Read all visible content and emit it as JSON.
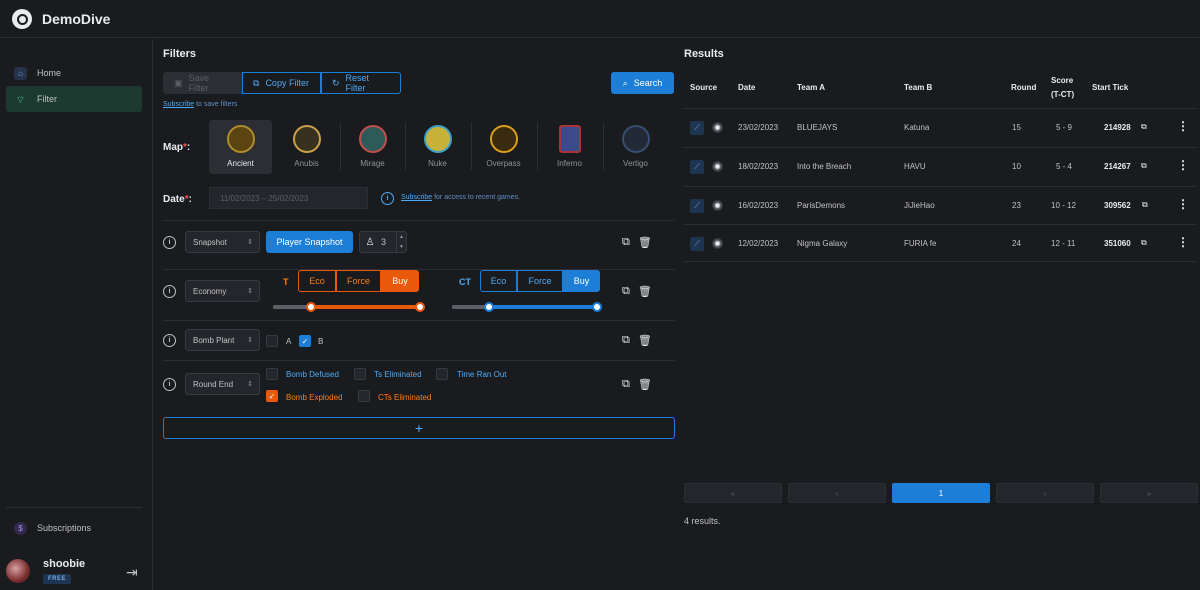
{
  "app": {
    "title": "DemoDive"
  },
  "sidebar": {
    "items": [
      {
        "label": "Home",
        "icon": "home-icon"
      },
      {
        "label": "Filter",
        "icon": "filter-icon",
        "active": true
      }
    ],
    "subscriptions_label": "Subscriptions",
    "user": {
      "name": "shoobie",
      "plan": "FREE"
    }
  },
  "filters": {
    "title": "Filters",
    "save_label": "Save Filter",
    "copy_label": "Copy Filter",
    "reset_label": "Reset Filter",
    "search_label": "Search",
    "subscribe_link": "Subscribe",
    "subscribe_note": " to save filters",
    "map_label": "Map",
    "maps": [
      {
        "name": "Ancient",
        "color": "#b08d2c",
        "active": true
      },
      {
        "name": "Anubis",
        "color": "#c9a24a"
      },
      {
        "name": "Mirage",
        "color": "#c0504d"
      },
      {
        "name": "Nuke",
        "color": "#3ea2c8"
      },
      {
        "name": "Overpass",
        "color": "#d8a018"
      },
      {
        "name": "Inferno",
        "color": "#a8343a"
      },
      {
        "name": "Vertigo",
        "color": "#4a6fa8"
      }
    ],
    "date_label": "Date",
    "date_range": "11/02/2023 – 25/02/2023",
    "date_subscribe_link": "Subscribe",
    "date_note": " for access to recent games.",
    "rows": {
      "snapshot": {
        "select": "Snapshot",
        "button": "Player Snapshot",
        "count": "3"
      },
      "economy": {
        "select": "Economy",
        "t_label": "T",
        "ct_label": "CT",
        "t_options": [
          "Eco",
          "Force",
          "Buy"
        ],
        "t_selected": "Buy",
        "ct_options": [
          "Eco",
          "Force",
          "Buy"
        ],
        "ct_selected": "Buy"
      },
      "bomb_plant": {
        "select": "Bomb Plant",
        "a_label": "A",
        "b_label": "B",
        "a_checked": false,
        "b_checked": true
      },
      "round_end": {
        "select": "Round End",
        "options": [
          {
            "label": "Bomb Defused",
            "checked": false
          },
          {
            "label": "Ts Eliminated",
            "checked": false
          },
          {
            "label": "Time Ran Out",
            "checked": false
          },
          {
            "label": "Bomb Exploded",
            "checked": true
          },
          {
            "label": "CTs Eliminated",
            "checked": false
          }
        ]
      }
    },
    "add_label": "+"
  },
  "results": {
    "title": "Results",
    "headers": {
      "source": "Source",
      "date": "Date",
      "team_a": "Team A",
      "team_b": "Team B",
      "round": "Round",
      "score": "Score",
      "score_sub": "(T-CT)",
      "start_tick": "Start Tick"
    },
    "rows": [
      {
        "date": "23/02/2023",
        "team_a": "BLUEJAYS",
        "team_b": "Katuna",
        "round": "15",
        "score": "5 - 9",
        "tick": "214928"
      },
      {
        "date": "18/02/2023",
        "team_a": "Into the Breach",
        "team_b": "HAVU",
        "round": "10",
        "score": "5 - 4",
        "tick": "214267"
      },
      {
        "date": "16/02/2023",
        "team_a": "ParisDemons",
        "team_b": "JiJieHao",
        "round": "23",
        "score": "10 - 12",
        "tick": "309562"
      },
      {
        "date": "12/02/2023",
        "team_a": "Nigma Galaxy",
        "team_b": "FURIA fe",
        "round": "24",
        "score": "12 - 11",
        "tick": "351060"
      }
    ],
    "pagination": {
      "first": "«",
      "prev": "‹",
      "current": "1",
      "next": "›",
      "last": "»"
    },
    "count_text": "4 results."
  },
  "colors": {
    "accent": "#1c7ed6",
    "t_side": "#e8590c",
    "active_nav": "#1d3a31"
  }
}
